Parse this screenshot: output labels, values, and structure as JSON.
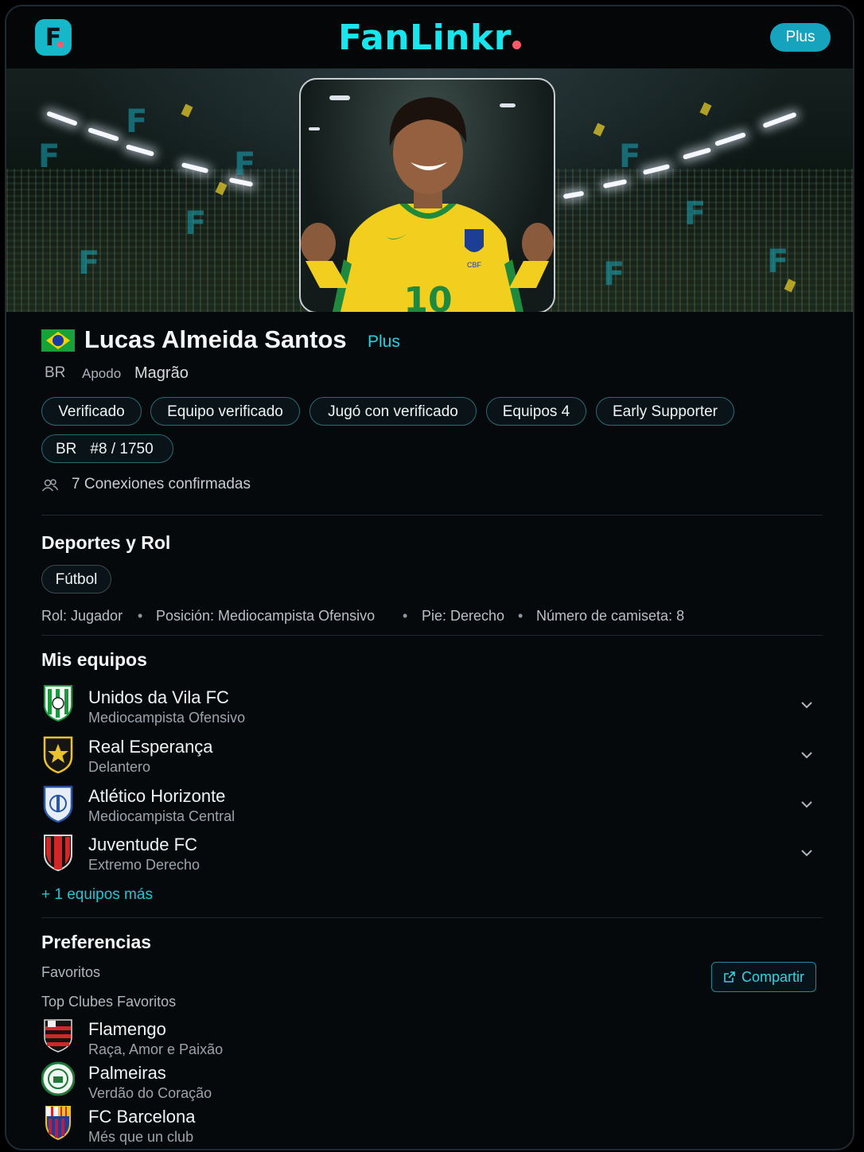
{
  "header": {
    "logo_letter": "F",
    "wordmark": "FanLinkr",
    "plus_button": "Plus"
  },
  "banner": {
    "watermark_letter": "F",
    "jersey_number": "10",
    "crest_text": "CBF"
  },
  "profile": {
    "name": "Lucas Almeida Santos",
    "tier": "Plus",
    "country": "BR",
    "nickname_label": "Apodo",
    "nickname": "Magrão",
    "badges": [
      "Verificado",
      "Equipo verificado",
      "Jugó con verificado",
      "Equipos 4",
      "Early Supporter"
    ],
    "rank": {
      "country": "BR",
      "position": "#8 / 1750"
    },
    "connections": "7 Conexiones confirmadas"
  },
  "sports": {
    "title": "Deportes y Rol",
    "sport_chip": "Fútbol",
    "role": "Rol: Jugador",
    "position": "Posición: Mediocampista Ofensivo",
    "foot": "Pie: Derecho",
    "shirt": "Número de camiseta: 8",
    "separator": "•"
  },
  "teams": {
    "title": "Mis equipos",
    "items": [
      {
        "name": "Unidos da Vila FC",
        "role": "Mediocampista Ofensivo"
      },
      {
        "name": "Real Esperança",
        "role": "Delantero"
      },
      {
        "name": "Atlético Horizonte",
        "role": "Mediocampista Central"
      },
      {
        "name": "Juventude FC",
        "role": "Extremo Derecho"
      }
    ],
    "more": "+ 1 equipos más"
  },
  "preferences": {
    "title": "Preferencias",
    "favorites_label": "Favoritos",
    "share_button": "Compartir",
    "top_clubs_label": "Top Clubes Favoritos",
    "clubs": [
      {
        "name": "Flamengo",
        "tagline": "Raça, Amor e Paixão"
      },
      {
        "name": "Palmeiras",
        "tagline": "Verdão do Coração"
      },
      {
        "name": "FC Barcelona",
        "tagline": "Més que un club"
      }
    ]
  },
  "colors": {
    "accent": "#18e6ee",
    "plus_pill": "#16a3bd",
    "link": "#22c4d6",
    "background": "#06090c"
  },
  "icons": [
    "app-logo-icon",
    "users-icon",
    "chevron-down-icon",
    "external-link-icon"
  ]
}
